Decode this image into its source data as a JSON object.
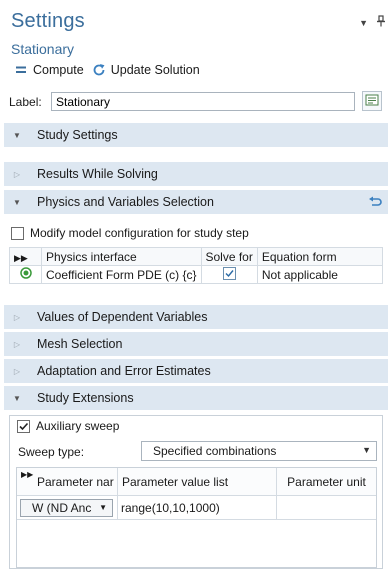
{
  "header": {
    "title": "Settings",
    "subtitle": "Stationary",
    "compute_label": "Compute",
    "update_label": "Update Solution"
  },
  "label_row": {
    "label": "Label:",
    "value": "Stationary"
  },
  "sections": {
    "study_settings": "Study Settings",
    "results_while_solving": "Results While Solving",
    "physics_selection": "Physics and Variables Selection",
    "values_dependent": "Values of Dependent Variables",
    "mesh_selection": "Mesh Selection",
    "adaptation": "Adaptation and Error Estimates",
    "study_extensions": "Study Extensions"
  },
  "physics": {
    "modify_checkbox_label": "Modify model configuration for study step",
    "modify_checked": false,
    "columns": [
      "Physics interface",
      "Solve for",
      "Equation form"
    ],
    "rows": [
      {
        "interface": "Coefficient Form PDE (c) {c}",
        "solve_for": true,
        "equation_form": "Not applicable"
      }
    ]
  },
  "extensions": {
    "aux_sweep_label": "Auxiliary sweep",
    "aux_sweep_checked": true,
    "sweep_type_label": "Sweep type:",
    "sweep_type_value": "Specified combinations",
    "columns": [
      "Parameter nar",
      "Parameter value list",
      "Parameter unit"
    ],
    "rows": [
      {
        "parameter": "W (ND Anc",
        "value_list": "range(10,10,1000)",
        "unit": ""
      }
    ]
  },
  "colors": {
    "accent": "#3b6e9c",
    "section_bg": "#dde7f1",
    "check_green": "#3a9a3a"
  }
}
